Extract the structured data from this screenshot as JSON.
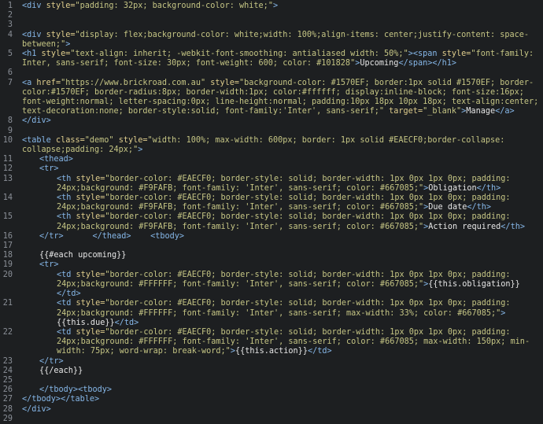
{
  "editor": {
    "lines": [
      {
        "n": "1",
        "segs": [
          {
            "t": "<div ",
            "c": "tag"
          },
          {
            "t": "style=",
            "c": "attr"
          },
          {
            "t": "\"padding: 32px; background-color: white;\"",
            "c": "str"
          },
          {
            "t": ">",
            "c": "tag"
          }
        ]
      },
      {
        "n": "2",
        "segs": []
      },
      {
        "n": "3",
        "segs": []
      },
      {
        "n": "4",
        "segs": [
          {
            "t": "<div ",
            "c": "tag"
          },
          {
            "t": "style=",
            "c": "attr"
          },
          {
            "t": "\"display: flex;background-color: white;width: 100%;align-items: center;justify-content: space-between;\"",
            "c": "str"
          },
          {
            "t": ">",
            "c": "tag"
          }
        ]
      },
      {
        "n": "5",
        "segs": [
          {
            "t": "<h1 ",
            "c": "tag"
          },
          {
            "t": "style=",
            "c": "attr"
          },
          {
            "t": "\"text-align: inherit; -webkit-font-smoothing: antialiased width: 50%;\"",
            "c": "str"
          },
          {
            "t": "><span ",
            "c": "tag"
          },
          {
            "t": "style=",
            "c": "attr"
          },
          {
            "t": "\"font-family: Inter, sans-serif; font-size: 30px; font-weight: 600; color: #101828\"",
            "c": "str"
          },
          {
            "t": ">",
            "c": "tag"
          },
          {
            "t": "Upcoming",
            "c": "plain"
          },
          {
            "t": "</span></h1>",
            "c": "tag"
          }
        ]
      },
      {
        "n": "6",
        "segs": []
      },
      {
        "n": "7",
        "segs": [
          {
            "t": "<a ",
            "c": "tag"
          },
          {
            "t": "href=",
            "c": "attr"
          },
          {
            "t": "\"https://www.brickroad.com.au\" ",
            "c": "str"
          },
          {
            "t": "style=",
            "c": "attr"
          },
          {
            "t": "\"background-color: #1570EF; border:1px solid #1570EF; border-color:#1570EF; border-radius:8px; border-width:1px; color:#ffffff; display:inline-block; font-size:16px; font-weight:normal; letter-spacing:0px; line-height:normal; padding:10px 18px 10px 18px; text-align:center; text-decoration:none; border-style:solid; font-family:'Inter', sans-serif;\" ",
            "c": "str"
          },
          {
            "t": "target=",
            "c": "attr"
          },
          {
            "t": "\"_blank\"",
            "c": "str"
          },
          {
            "t": ">",
            "c": "tag"
          },
          {
            "t": "Manage",
            "c": "plain"
          },
          {
            "t": "</a>",
            "c": "tag"
          }
        ]
      },
      {
        "n": "8",
        "segs": [
          {
            "t": "</div>",
            "c": "tag"
          }
        ]
      },
      {
        "n": "9",
        "segs": []
      },
      {
        "n": "10",
        "segs": [
          {
            "t": "<table ",
            "c": "tag"
          },
          {
            "t": "class=",
            "c": "attr"
          },
          {
            "t": "\"demo\" ",
            "c": "str"
          },
          {
            "t": "style=",
            "c": "attr"
          },
          {
            "t": "\"width: 100%; max-width: 600px; border: 1px solid #EAECF0;border-collapse: collapse;padding: 24px;\"",
            "c": "str"
          },
          {
            "t": ">",
            "c": "tag"
          }
        ]
      },
      {
        "n": "11",
        "indent": 1,
        "segs": [
          {
            "t": "<thead>",
            "c": "tag"
          }
        ]
      },
      {
        "n": "12",
        "indent": 1,
        "segs": [
          {
            "t": "<tr>",
            "c": "tag"
          }
        ]
      },
      {
        "n": "13",
        "indent": 2,
        "segs": [
          {
            "t": "<th ",
            "c": "tag"
          },
          {
            "t": "style=",
            "c": "attr"
          },
          {
            "t": "\"border-color: #EAECF0; border-style: solid; border-width: 1px 0px 1px 0px; padding: 24px;background: #F9FAFB; font-family: 'Inter', sans-serif; color: #667085;\"",
            "c": "str"
          },
          {
            "t": ">",
            "c": "tag"
          },
          {
            "t": "Obligation",
            "c": "plain"
          },
          {
            "t": "</th>",
            "c": "tag"
          }
        ]
      },
      {
        "n": "14",
        "indent": 2,
        "segs": [
          {
            "t": "<th ",
            "c": "tag"
          },
          {
            "t": "style=",
            "c": "attr"
          },
          {
            "t": "\"border-color: #EAECF0; border-style: solid; border-width: 1px 0px 1px 0px; padding: 24px;background: #F9FAFB; font-family: 'Inter', sans-serif; color: #667085;\"",
            "c": "str"
          },
          {
            "t": ">",
            "c": "tag"
          },
          {
            "t": "Due date",
            "c": "plain"
          },
          {
            "t": "</th>",
            "c": "tag"
          }
        ]
      },
      {
        "n": "15",
        "indent": 2,
        "segs": [
          {
            "t": "<th ",
            "c": "tag"
          },
          {
            "t": "style=",
            "c": "attr"
          },
          {
            "t": "\"border-color: #EAECF0; border-style: solid; border-width: 1px 0px 1px 0px; padding: 24px;background: #F9FAFB; font-family: 'Inter', sans-serif; color: #667085;\"",
            "c": "str"
          },
          {
            "t": ">",
            "c": "tag"
          },
          {
            "t": "Action required",
            "c": "plain"
          },
          {
            "t": "</th>",
            "c": "tag"
          }
        ]
      },
      {
        "n": "16",
        "indent": 1,
        "segs": [
          {
            "t": "</tr>      </thead>    <tbody>",
            "c": "tag"
          }
        ]
      },
      {
        "n": "17",
        "segs": []
      },
      {
        "n": "18",
        "indent": 1,
        "segs": [
          {
            "t": "{{#each upcoming}}",
            "c": "plain"
          }
        ]
      },
      {
        "n": "19",
        "indent": 1,
        "segs": [
          {
            "t": "<tr>",
            "c": "tag"
          }
        ]
      },
      {
        "n": "20",
        "indent": 2,
        "segs": [
          {
            "t": "<td ",
            "c": "tag"
          },
          {
            "t": "style=",
            "c": "attr"
          },
          {
            "t": "\"border-color: #EAECF0; border-style: solid; border-width: 1px 0px 1px 0px; padding: 24px;background: #FFFFFF; font-family: 'Inter', sans-serif; color: #667085;\"",
            "c": "str"
          },
          {
            "t": ">",
            "c": "tag"
          },
          {
            "t": "{{this.obligation}}",
            "c": "plain"
          },
          {
            "t": "</td>",
            "c": "tag"
          }
        ]
      },
      {
        "n": "21",
        "indent": 2,
        "segs": [
          {
            "t": "<td ",
            "c": "tag"
          },
          {
            "t": "style=",
            "c": "attr"
          },
          {
            "t": "\"border-color: #EAECF0; border-style: solid; border-width: 1px 0px 1px 0px; padding: 24px;background: #FFFFFF; font-family: 'Inter', sans-serif; max-width: 33%; color: #667085;\"",
            "c": "str"
          },
          {
            "t": ">",
            "c": "tag"
          },
          {
            "t": "{{this.due}}",
            "c": "plain"
          },
          {
            "t": "</td>",
            "c": "tag"
          }
        ]
      },
      {
        "n": "22",
        "indent": 2,
        "segs": [
          {
            "t": "<td ",
            "c": "tag"
          },
          {
            "t": "style=",
            "c": "attr"
          },
          {
            "t": "\"border-color: #EAECF0; border-style: solid; border-width: 1px 0px 1px 0px; padding: 24px;background: #FFFFFF; font-family: 'Inter', sans-serif; color: #667085; max-width: 150px; min-width: 75px; word-wrap: break-word;\"",
            "c": "str"
          },
          {
            "t": ">",
            "c": "tag"
          },
          {
            "t": "{{this.action}}",
            "c": "plain"
          },
          {
            "t": "</td>",
            "c": "tag"
          }
        ]
      },
      {
        "n": "23",
        "indent": 1,
        "segs": [
          {
            "t": "</tr>",
            "c": "tag"
          }
        ]
      },
      {
        "n": "24",
        "indent": 1,
        "segs": [
          {
            "t": "{{/each}}",
            "c": "plain"
          }
        ]
      },
      {
        "n": "25",
        "segs": []
      },
      {
        "n": "26",
        "indent": 1,
        "segs": [
          {
            "t": "</tbody><tbody>",
            "c": "tag"
          }
        ]
      },
      {
        "n": "27",
        "segs": [
          {
            "t": "</tbody></table>",
            "c": "tag"
          }
        ]
      },
      {
        "n": "28",
        "segs": [
          {
            "t": "</div>",
            "c": "tag"
          }
        ]
      },
      {
        "n": "29",
        "segs": []
      }
    ]
  },
  "colors": {
    "background": "#1d1f21",
    "tag": "#86b7e8",
    "attribute": "#e0ce8d",
    "string": "#c5c584",
    "line_number": "#8a8f97"
  }
}
